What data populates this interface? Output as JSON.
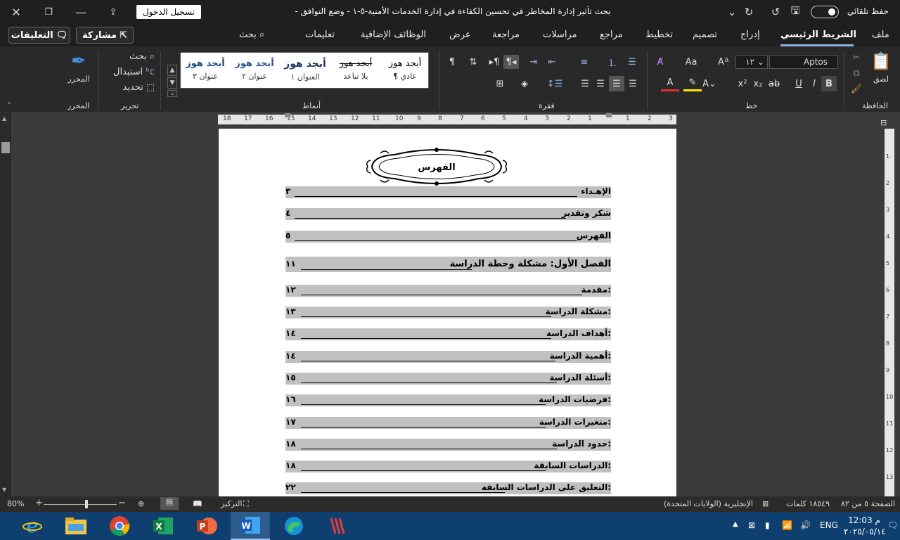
{
  "titlebar": {
    "signin": "تسجيل الدخول",
    "doc_title": "بحث تأثير إدارة المخاطر في تحسين الكفاءة في إدارة الخدمات الأمنية-٥-١ - وضع التوافق -",
    "autosave": "حفظ تلقائي"
  },
  "tabs": [
    "ملف",
    "الشريط الرئيسي",
    "إدراج",
    "تصميم",
    "تخطيط",
    "مراجع",
    "مراسلات",
    "مراجعة",
    "عرض",
    "الوظائف الإضافية",
    "تعليمات",
    "بحث"
  ],
  "active_tab": "الشريط الرئيسي",
  "share_label": "مشاركة",
  "comments_label": "التعليقات",
  "ribbon": {
    "clipboard": {
      "paste": "لصق",
      "label": "الحافظة"
    },
    "font": {
      "name": "Aptos",
      "size": "١٢",
      "label": "خط"
    },
    "paragraph": {
      "label": "فقرة"
    },
    "styles": {
      "label": "أنماط",
      "items": [
        {
          "sample": "أبجد هوز",
          "name": "¶ عادي"
        },
        {
          "sample": "أبجد هوز",
          "name": "بلا تباعد"
        },
        {
          "sample": "أبجد هوز",
          "name": "العنوان ١"
        },
        {
          "sample": "أبجد هوز",
          "name": "عنوان ٢"
        },
        {
          "sample": "أبجد هوز",
          "name": "عنوان ٣"
        }
      ]
    },
    "editing": {
      "find": "بحث",
      "replace": "استبدال",
      "select": "تحديد",
      "label": "تحرير"
    },
    "editor": {
      "name": "المحرر",
      "label": "المحرر"
    }
  },
  "ruler": [
    "3",
    "2",
    "1",
    "1",
    "2",
    "3",
    "4",
    "5",
    "6",
    "7",
    "8",
    "9",
    "10",
    "11",
    "12",
    "13",
    "14",
    "15",
    "16",
    "17",
    "18"
  ],
  "vruler": [
    "1",
    "2",
    "3",
    "4",
    "5",
    "6",
    "7",
    "8",
    "9",
    "10",
    "11",
    "12",
    "13"
  ],
  "document": {
    "heading": "الفهرس",
    "toc": [
      {
        "label": "الإهـداء",
        "page": "٣"
      },
      {
        "label": "شكر وتقدير",
        "page": "٤"
      },
      {
        "label": "الفهرس",
        "page": "٥"
      },
      {
        "label": "الفصل الأول: مشكلة وخطة الدراسة",
        "page": "١١"
      },
      {
        "label": "مقدمة:",
        "page": "١٢"
      },
      {
        "label": "مشكلة الدراسة:",
        "page": "١٣"
      },
      {
        "label": "أهداف الدراسة:",
        "page": "١٤"
      },
      {
        "label": "أهمية الدراسة:",
        "page": "١٤"
      },
      {
        "label": "أسئلة الدراسة:",
        "page": "١٥"
      },
      {
        "label": "فرضيات الدراسة:",
        "page": "١٦"
      },
      {
        "label": "متغيرات الدراسة:",
        "page": "١٧"
      },
      {
        "label": "حدود الدراسة:",
        "page": "١٨"
      },
      {
        "label": "الدراسات السابقة:",
        "page": "١٨"
      },
      {
        "label": "التعليق على الدراسات السابقة:",
        "page": "٢٢"
      }
    ]
  },
  "statusbar": {
    "page": "الصفحة ٥ من ٨٢",
    "words": "١٨٥٤٩ كلمات",
    "language": "الإنجليزية (الولايات المتحدة)",
    "focus": "التركيز",
    "zoom": "80%"
  },
  "taskbar": {
    "lang": "ENG",
    "time": "12:03 م",
    "date": "٢٠٢٥/٠٥/١٤"
  }
}
